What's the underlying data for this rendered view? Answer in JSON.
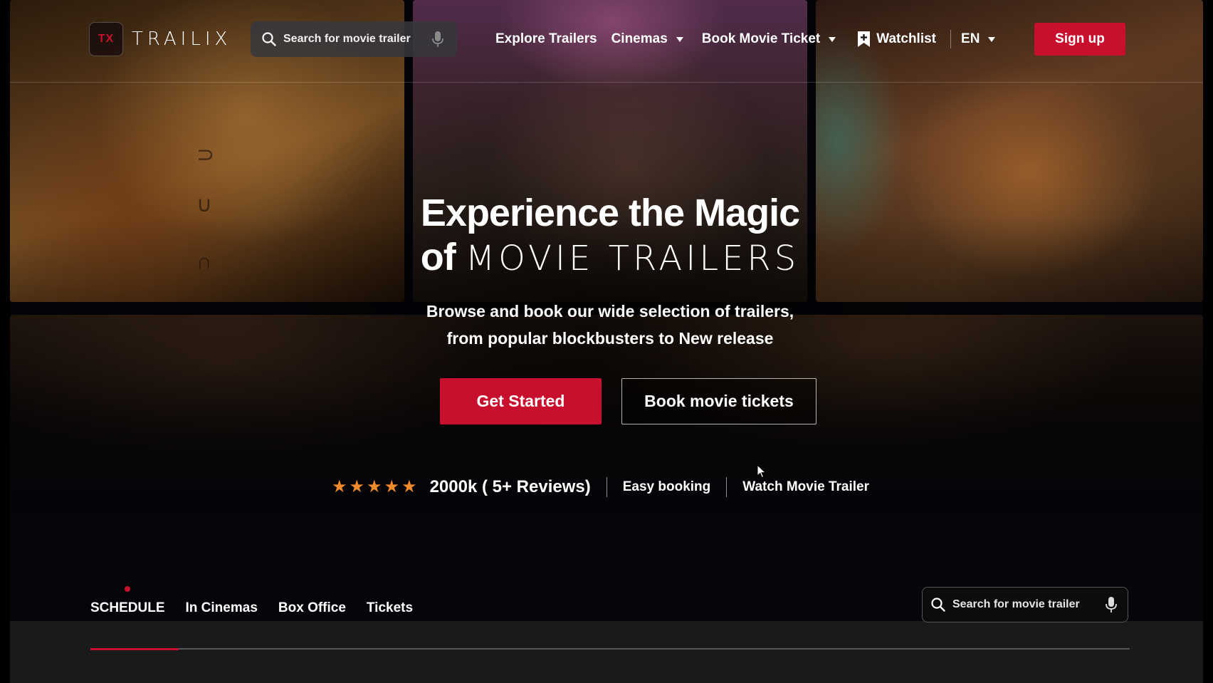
{
  "brand": {
    "logo_mark": "TX",
    "name": "TRAILIX"
  },
  "header": {
    "search": {
      "placeholder": "Search for movie trailer"
    },
    "nav": {
      "explore": "Explore Trailers",
      "cinemas": "Cinemas",
      "book": "Book Movie Ticket",
      "watchlist": "Watchlist",
      "language": "EN"
    },
    "signup_label": "Sign up"
  },
  "hero": {
    "title_line1": "Experience the Magic",
    "title_of": "of",
    "title_accent": "MOVIE TRAILERS",
    "subtitle_line1": "Browse and book our wide selection of trailers,",
    "subtitle_line2": "from popular blockbusters to New release",
    "primary_cta": "Get Started",
    "secondary_cta": "Book movie tickets",
    "rating": {
      "stars": 5,
      "text": "2000k ( 5+ Reviews)"
    },
    "features": [
      "Easy booking",
      "Watch Movie Trailer"
    ]
  },
  "schedule": {
    "tabs": [
      "SCHEDULE",
      "In Cinemas",
      "Box Office",
      "Tickets"
    ],
    "active_tab": 0,
    "progress": 0.085,
    "search": {
      "placeholder": "Search for movie trailer"
    }
  },
  "colors": {
    "accent": "#c8102e",
    "star": "#f08a2c"
  }
}
